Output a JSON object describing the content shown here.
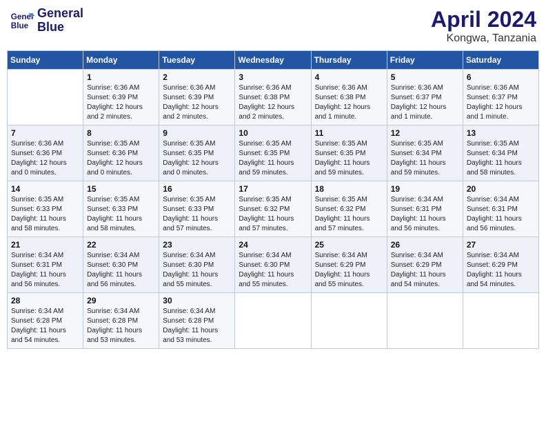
{
  "header": {
    "logo_line1": "General",
    "logo_line2": "Blue",
    "title": "April 2024",
    "subtitle": "Kongwa, Tanzania"
  },
  "calendar": {
    "headers": [
      "Sunday",
      "Monday",
      "Tuesday",
      "Wednesday",
      "Thursday",
      "Friday",
      "Saturday"
    ],
    "weeks": [
      [
        {
          "day": "",
          "info": ""
        },
        {
          "day": "1",
          "info": "Sunrise: 6:36 AM\nSunset: 6:39 PM\nDaylight: 12 hours\nand 2 minutes."
        },
        {
          "day": "2",
          "info": "Sunrise: 6:36 AM\nSunset: 6:39 PM\nDaylight: 12 hours\nand 2 minutes."
        },
        {
          "day": "3",
          "info": "Sunrise: 6:36 AM\nSunset: 6:38 PM\nDaylight: 12 hours\nand 2 minutes."
        },
        {
          "day": "4",
          "info": "Sunrise: 6:36 AM\nSunset: 6:38 PM\nDaylight: 12 hours\nand 1 minute."
        },
        {
          "day": "5",
          "info": "Sunrise: 6:36 AM\nSunset: 6:37 PM\nDaylight: 12 hours\nand 1 minute."
        },
        {
          "day": "6",
          "info": "Sunrise: 6:36 AM\nSunset: 6:37 PM\nDaylight: 12 hours\nand 1 minute."
        }
      ],
      [
        {
          "day": "7",
          "info": "Sunrise: 6:36 AM\nSunset: 6:36 PM\nDaylight: 12 hours\nand 0 minutes."
        },
        {
          "day": "8",
          "info": "Sunrise: 6:35 AM\nSunset: 6:36 PM\nDaylight: 12 hours\nand 0 minutes."
        },
        {
          "day": "9",
          "info": "Sunrise: 6:35 AM\nSunset: 6:35 PM\nDaylight: 12 hours\nand 0 minutes."
        },
        {
          "day": "10",
          "info": "Sunrise: 6:35 AM\nSunset: 6:35 PM\nDaylight: 11 hours\nand 59 minutes."
        },
        {
          "day": "11",
          "info": "Sunrise: 6:35 AM\nSunset: 6:35 PM\nDaylight: 11 hours\nand 59 minutes."
        },
        {
          "day": "12",
          "info": "Sunrise: 6:35 AM\nSunset: 6:34 PM\nDaylight: 11 hours\nand 59 minutes."
        },
        {
          "day": "13",
          "info": "Sunrise: 6:35 AM\nSunset: 6:34 PM\nDaylight: 11 hours\nand 58 minutes."
        }
      ],
      [
        {
          "day": "14",
          "info": "Sunrise: 6:35 AM\nSunset: 6:33 PM\nDaylight: 11 hours\nand 58 minutes."
        },
        {
          "day": "15",
          "info": "Sunrise: 6:35 AM\nSunset: 6:33 PM\nDaylight: 11 hours\nand 58 minutes."
        },
        {
          "day": "16",
          "info": "Sunrise: 6:35 AM\nSunset: 6:33 PM\nDaylight: 11 hours\nand 57 minutes."
        },
        {
          "day": "17",
          "info": "Sunrise: 6:35 AM\nSunset: 6:32 PM\nDaylight: 11 hours\nand 57 minutes."
        },
        {
          "day": "18",
          "info": "Sunrise: 6:35 AM\nSunset: 6:32 PM\nDaylight: 11 hours\nand 57 minutes."
        },
        {
          "day": "19",
          "info": "Sunrise: 6:34 AM\nSunset: 6:31 PM\nDaylight: 11 hours\nand 56 minutes."
        },
        {
          "day": "20",
          "info": "Sunrise: 6:34 AM\nSunset: 6:31 PM\nDaylight: 11 hours\nand 56 minutes."
        }
      ],
      [
        {
          "day": "21",
          "info": "Sunrise: 6:34 AM\nSunset: 6:31 PM\nDaylight: 11 hours\nand 56 minutes."
        },
        {
          "day": "22",
          "info": "Sunrise: 6:34 AM\nSunset: 6:30 PM\nDaylight: 11 hours\nand 56 minutes."
        },
        {
          "day": "23",
          "info": "Sunrise: 6:34 AM\nSunset: 6:30 PM\nDaylight: 11 hours\nand 55 minutes."
        },
        {
          "day": "24",
          "info": "Sunrise: 6:34 AM\nSunset: 6:30 PM\nDaylight: 11 hours\nand 55 minutes."
        },
        {
          "day": "25",
          "info": "Sunrise: 6:34 AM\nSunset: 6:29 PM\nDaylight: 11 hours\nand 55 minutes."
        },
        {
          "day": "26",
          "info": "Sunrise: 6:34 AM\nSunset: 6:29 PM\nDaylight: 11 hours\nand 54 minutes."
        },
        {
          "day": "27",
          "info": "Sunrise: 6:34 AM\nSunset: 6:29 PM\nDaylight: 11 hours\nand 54 minutes."
        }
      ],
      [
        {
          "day": "28",
          "info": "Sunrise: 6:34 AM\nSunset: 6:28 PM\nDaylight: 11 hours\nand 54 minutes."
        },
        {
          "day": "29",
          "info": "Sunrise: 6:34 AM\nSunset: 6:28 PM\nDaylight: 11 hours\nand 53 minutes."
        },
        {
          "day": "30",
          "info": "Sunrise: 6:34 AM\nSunset: 6:28 PM\nDaylight: 11 hours\nand 53 minutes."
        },
        {
          "day": "",
          "info": ""
        },
        {
          "day": "",
          "info": ""
        },
        {
          "day": "",
          "info": ""
        },
        {
          "day": "",
          "info": ""
        }
      ]
    ]
  }
}
